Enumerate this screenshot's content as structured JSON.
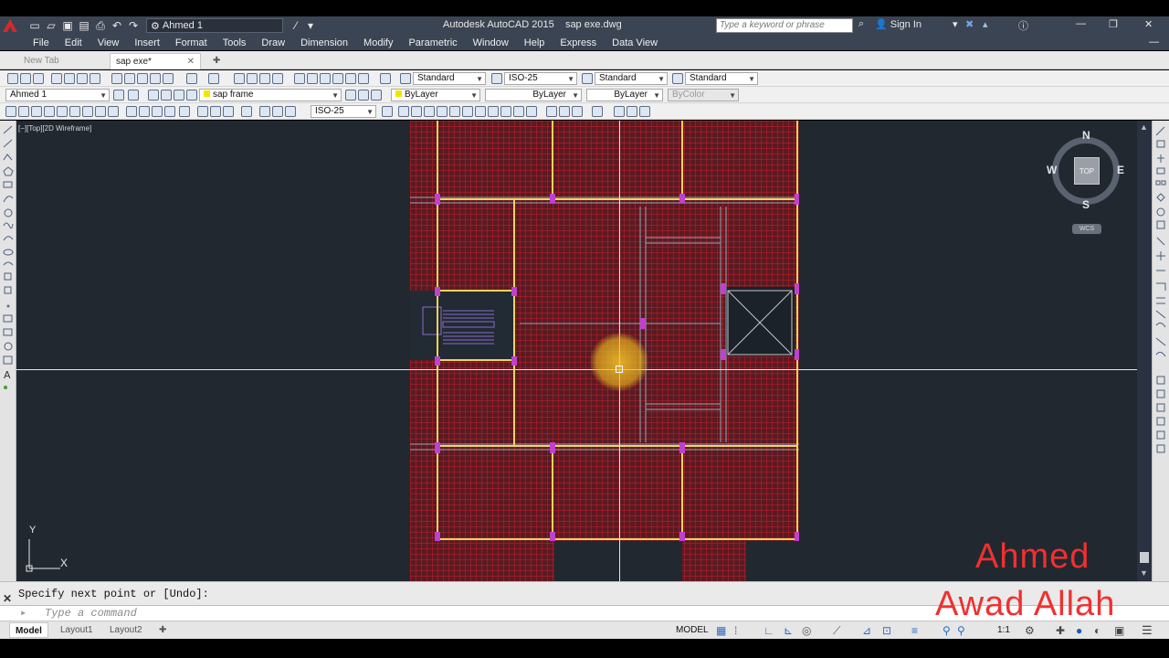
{
  "window": {
    "app_title": "Autodesk AutoCAD 2015",
    "file_name": "sap exe.dwg",
    "workspace": "Ahmed 1",
    "search_placeholder": "Type a keyword or phrase",
    "sign_in": "Sign In"
  },
  "menu": [
    "File",
    "Edit",
    "View",
    "Insert",
    "Format",
    "Tools",
    "Draw",
    "Dimension",
    "Modify",
    "Parametric",
    "Window",
    "Help",
    "Express",
    "Data View"
  ],
  "tabs": [
    {
      "label": "New Tab",
      "active": false
    },
    {
      "label": "sap exe*",
      "active": true
    }
  ],
  "styles_toolbar": {
    "text_style": "Standard",
    "dim_style": "ISO-25",
    "table_style": "Standard",
    "mleader_style": "Standard"
  },
  "layers_toolbar": {
    "workspace": "Ahmed 1",
    "layer": "sap frame",
    "color": "ByLayer",
    "linetype": "ByLayer",
    "lineweight": "ByLayer",
    "plotstyle": "ByColor"
  },
  "dim_toolbar": {
    "dim_style": "ISO-25"
  },
  "viewport": {
    "label": "[−][Top][2D Wireframe]"
  },
  "viewcube": {
    "north": "N",
    "south": "S",
    "east": "E",
    "west": "W",
    "face": "TOP",
    "ucs": "WCS"
  },
  "ucs_icon": {
    "x": "X",
    "y": "Y"
  },
  "command": {
    "history": "Specify next point or [Undo]:",
    "placeholder": "Type a command"
  },
  "layout_tabs": [
    "Model",
    "Layout1",
    "Layout2"
  ],
  "status": {
    "model": "MODEL",
    "scale": "1:1"
  },
  "watermark": {
    "line1": "Ahmed",
    "line2": "Awad Allah"
  },
  "colors": {
    "grid": "#c8202c",
    "beam": "#f2d35a",
    "column": "#c040d0",
    "background": "#212830",
    "cursor": "#ffffff"
  }
}
